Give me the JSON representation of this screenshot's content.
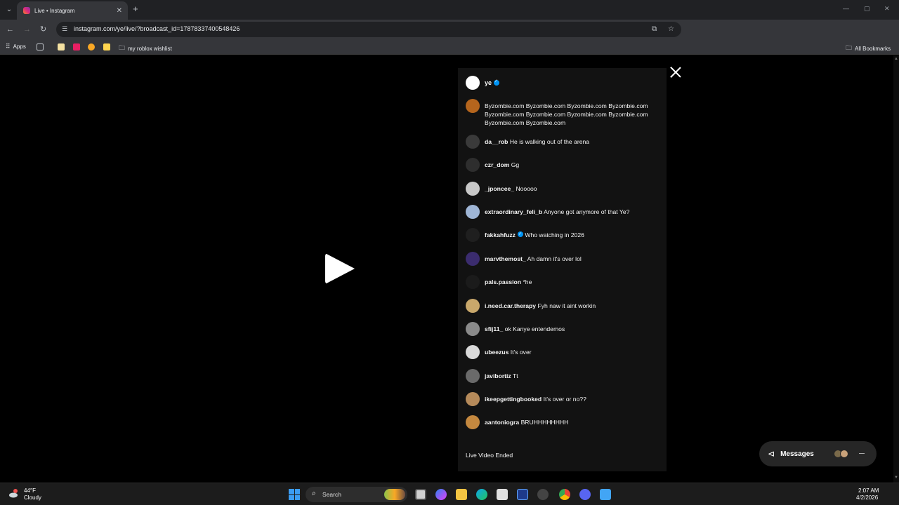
{
  "browser": {
    "tab_title": "Live • Instagram",
    "tab_close": "✕",
    "new_tab": "+",
    "url": "instagram.com/ye/live/?broadcast_id=17878337400548426",
    "bookmarks": {
      "apps_label": "Apps",
      "folder_label": "my roblox wishlist",
      "all_bookmarks_label": "All Bookmarks"
    }
  },
  "live": {
    "host_name": "ye",
    "comments": [
      {
        "user": "",
        "text": "Byzombie.com Byzombie.com Byzombie.com Byzombie.com Byzombie.com Byzombie.com Byzombie.com Byzombie.com Byzombie.com Byzombie.com",
        "avatar_color": "#b5651d"
      },
      {
        "user": "da__rob",
        "text": "He is walking out of the arena",
        "avatar_color": "#3a3a3a"
      },
      {
        "user": "czr_dom",
        "text": "Gg",
        "avatar_color": "#2e2e2e"
      },
      {
        "user": "_jponcee_",
        "text": "Nooooo",
        "avatar_color": "#c8c8c8"
      },
      {
        "user": "extraordinary_feli_b",
        "text": "Anyone got anymore of that Ye?",
        "avatar_color": "#9fb6d6"
      },
      {
        "user": "fakkahfuzz",
        "text": "Who watching in 2026",
        "avatar_color": "#1f1f1f",
        "verified": true
      },
      {
        "user": "marvthemost_",
        "text": "Ah damn it's over lol",
        "avatar_color": "#3b2c6e"
      },
      {
        "user": "pals.passion",
        "text": "*he",
        "avatar_color": "#1b1b1b"
      },
      {
        "user": "i.need.car.therapy",
        "text": "Fyh naw it aint workin",
        "avatar_color": "#c9a86b"
      },
      {
        "user": "sfij11_",
        "text": "ok Kanye entendemos",
        "avatar_color": "#8a8a8a"
      },
      {
        "user": "ubeezus",
        "text": "It's over",
        "avatar_color": "#d9d9d9"
      },
      {
        "user": "javibortiz",
        "text": "Tt",
        "avatar_color": "#6a6a6a"
      },
      {
        "user": "ikeepgettingbooked",
        "text": "It's over or no??",
        "avatar_color": "#b58a5a"
      },
      {
        "user": "aantoniogra",
        "text": "BRUHHHHHHHH",
        "avatar_color": "#c4883f"
      }
    ],
    "status": "Live Video Ended"
  },
  "messages": {
    "label": "Messages"
  },
  "taskbar": {
    "weather_temp": "44°F",
    "weather_condition": "Cloudy",
    "search_label": "Search",
    "time": "2:07 AM",
    "date": "4/2/2026"
  }
}
